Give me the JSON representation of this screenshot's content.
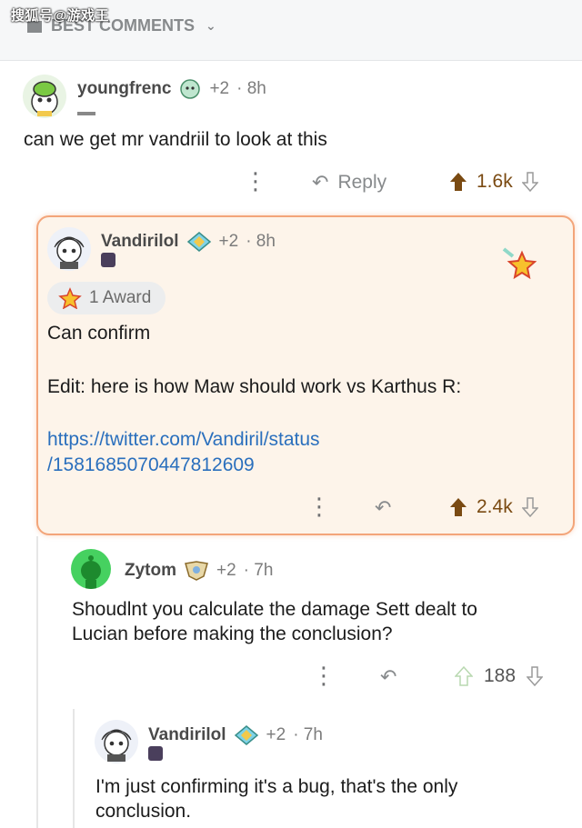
{
  "watermark": "搜狐号@游戏王",
  "sort": {
    "label": "BEST COMMENTS"
  },
  "comments": [
    {
      "username": "youngfrenc",
      "karma": "+2",
      "age": "· 8h",
      "body": "can we get mr vandriil to look at this",
      "reply_label": "Reply",
      "votes": "1.6k"
    },
    {
      "username": "Vandirilol",
      "karma": "+2",
      "age": "· 8h",
      "award": "1 Award",
      "body_line1": "Can confirm",
      "body_line2": "Edit: here is how Maw should work vs Karthus R:",
      "link_line1": "https://twitter.com/Vandiril/status",
      "link_line2": "/1581685070447812609",
      "votes": "2.4k"
    },
    {
      "username": "Zytom",
      "karma": "+2",
      "age": "· 7h",
      "body_line1": "Shoudlnt you calculate the damage Sett dealt to",
      "body_line2": "Lucian before making the conclusion?",
      "votes": "188"
    },
    {
      "username": "Vandirilol",
      "karma": "+2",
      "age": "· 7h",
      "body_line1": "I'm just confirming it's a bug, that's the only",
      "body_line2": "conclusion."
    }
  ],
  "colors": {
    "accent": "#f3a57a",
    "link": "#2a6fbd",
    "upvote": "#7a4a12"
  }
}
